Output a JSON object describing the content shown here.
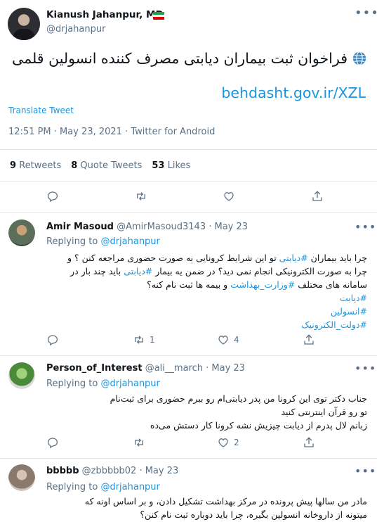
{
  "main_tweet": {
    "author_name": "Kianush Jahanpur, MD",
    "handle": "@drjahanpur",
    "text": "فراخوان ثبت بیماران دیابتی مصرف کننده انسولین قلمی",
    "link": "behdasht.gov.ir/XZL",
    "translate_label": "Translate Tweet",
    "meta": "12:51 PM · May 23, 2021 · Twitter for Android",
    "stats": {
      "retweets_count": "9",
      "retweets_label": "Retweets",
      "quotes_count": "8",
      "quotes_label": "Quote Tweets",
      "likes_count": "53",
      "likes_label": "Likes"
    },
    "icons": [
      "globe-icon",
      "reply-icon",
      "retweet-icon",
      "like-icon",
      "share-icon",
      "more-icon"
    ],
    "flag_colors": [
      "#239f40",
      "#ffffff",
      "#da0000"
    ]
  },
  "replies": [
    {
      "author_name": "Amir Masoud",
      "handle": "@AmirMasoud3143",
      "date": "· May 23",
      "replying_prefix": "Replying to",
      "replying_to": "@drjahanpur",
      "lines": [
        [
          "چرا باید بیماران ",
          "#دیابتی",
          " تو این شرایط کرونایی به صورت حضوری مراجعه کنن ؟ و"
        ],
        [
          "چرا به صورت الکترونیکی انجام نمی دید؟ در ضمن یه بیمار ",
          "#دیابتی",
          " باید چند بار در"
        ],
        [
          "سامانه های مختلف ",
          "#وزارت_بهداشت",
          " و بیمه ها ثبت نام کنه؟"
        ],
        [
          "",
          "#دیابت",
          ""
        ],
        [
          "",
          "#انسولین",
          ""
        ],
        [
          "",
          "#دولت_الکترونیک",
          ""
        ]
      ],
      "retweets": "1",
      "likes": "4"
    },
    {
      "author_name": "Person_of_Interest",
      "handle": "@ali__march",
      "date": "· May 23",
      "replying_prefix": "Replying to",
      "replying_to": "@drjahanpur",
      "lines": [
        "جناب دکتر توی این کرونا من پدر دیابتی‌ام رو ببرم حضوری برای ثبت‌نام",
        "تو رو قرآن اینترنتی کنید",
        "زبانم لال پدرم از دیابت چیزیش نشه کرونا کار دستش می‌ده"
      ],
      "likes": "2"
    },
    {
      "author_name": "bbbbb",
      "handle": "@zbbbbb02",
      "date": "· May 23",
      "replying_prefix": "Replying to",
      "replying_to": "@drjahanpur",
      "lines": [
        "مادر من سالها پیش پرونده در مرکز بهداشت تشکیل دادن، و بر اساس اونه که",
        "میتونه از داروخانه انسولین بگیره، چرا باید دوباره ثبت نام کنن؟"
      ]
    }
  ]
}
